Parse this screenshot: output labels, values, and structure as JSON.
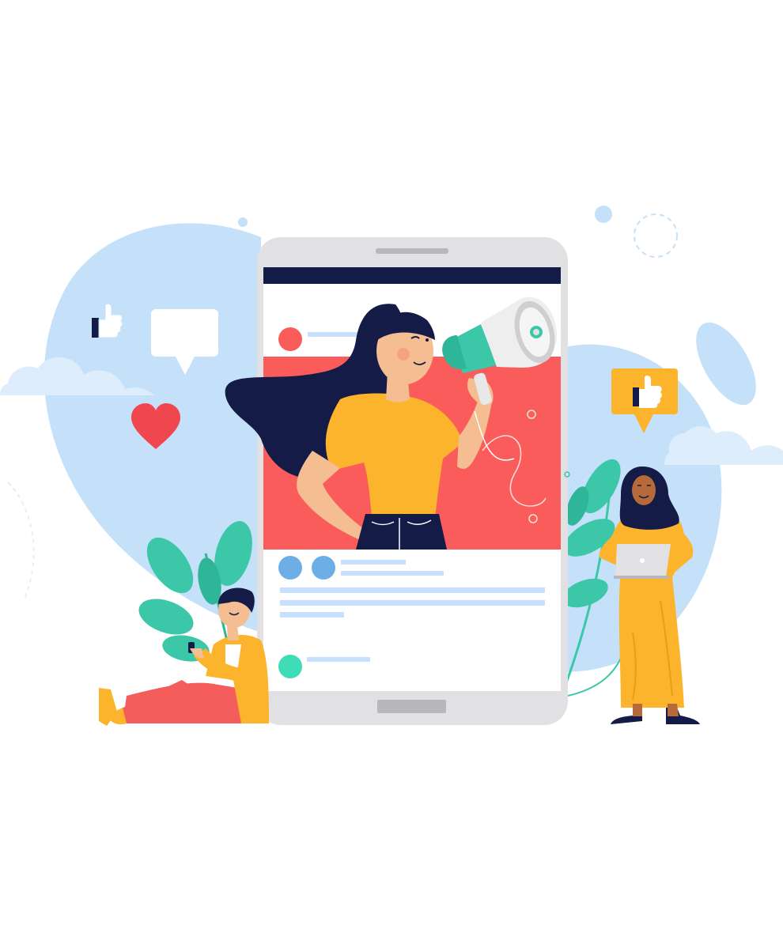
{
  "illustration": {
    "subject": "social-media-marketing",
    "icons": [
      "thumbs-up-icon",
      "speech-bubble-icon",
      "heart-icon",
      "thumbs-up-badge-icon",
      "megaphone-icon",
      "smartphone-icon",
      "laptop-icon",
      "phone-icon"
    ],
    "colors": {
      "blob": "#c5e0f9",
      "cloud": "#ddedfb",
      "phone_frame": "#e1e1e3",
      "phone_bar": "#131b46",
      "screen": "#ffffff",
      "post_bg": "#fa5c5c",
      "skin": "#f4bd92",
      "hair": "#131b46",
      "shirt": "#fbb42b",
      "megaphone": "#3cc8a8",
      "leaf": "#3cc8a8",
      "heart": "#f0474f",
      "skeleton_line": "#c7e0fb",
      "avatar_blue": "#6eaee6",
      "avatar_green": "#3fdcb8",
      "pants_red": "#f55d5d",
      "dark": "#131b46"
    }
  }
}
